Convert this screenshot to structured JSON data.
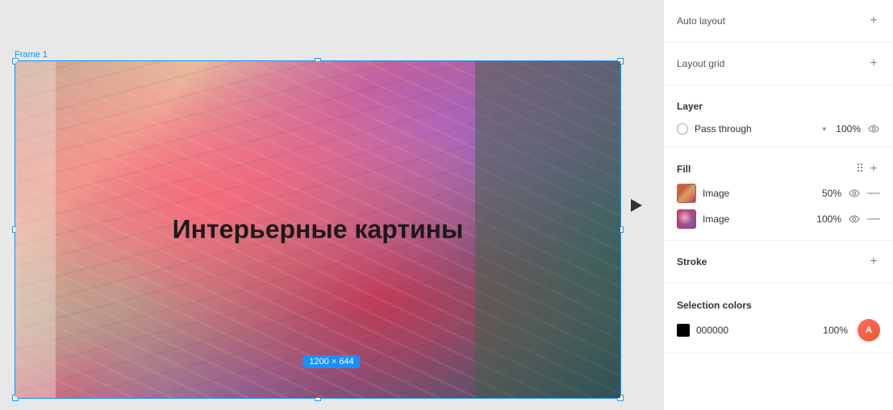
{
  "canvas": {
    "frame_label": "Frame 1",
    "frame_text": "Интерьерные картины",
    "size_badge": "1200 × 644"
  },
  "panel": {
    "auto_layout": {
      "title": "Auto layout",
      "add_label": "+"
    },
    "layout_grid": {
      "title": "Layout grid",
      "add_label": "+"
    },
    "layer": {
      "title": "Layer",
      "blend_mode": "Pass through",
      "blend_arrow": "▾",
      "opacity": "100%",
      "visibility": "👁"
    },
    "fill": {
      "title": "Fill",
      "add_label": "+",
      "items": [
        {
          "label": "Image",
          "opacity": "50%",
          "visibility": "👁",
          "remove": "—"
        },
        {
          "label": "Image",
          "opacity": "100%",
          "visibility": "👁",
          "remove": "—"
        }
      ]
    },
    "stroke": {
      "title": "Stroke",
      "add_label": "+"
    },
    "selection_colors": {
      "title": "Selection colors",
      "items": [
        {
          "hex": "000000",
          "opacity": "100%"
        }
      ]
    }
  }
}
